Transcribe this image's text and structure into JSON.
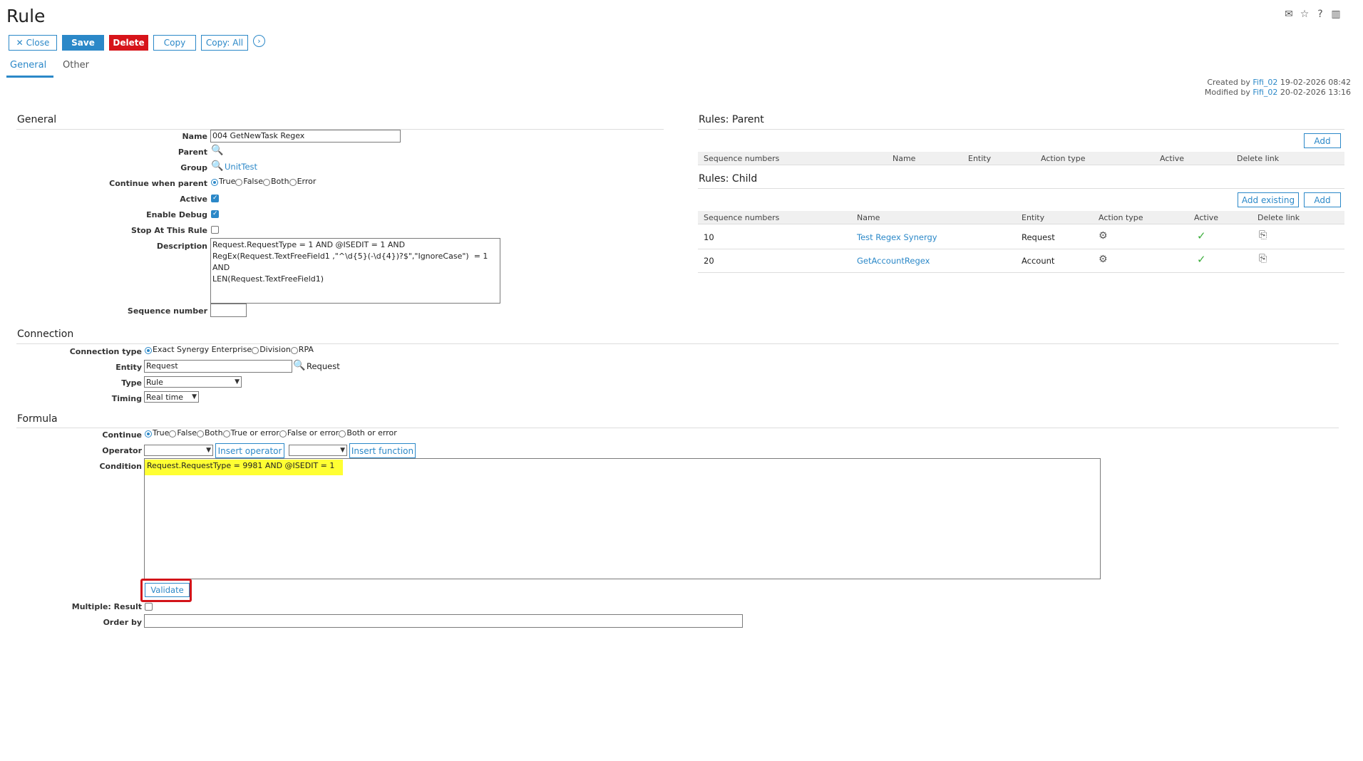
{
  "page": {
    "title": "Rule"
  },
  "toolbar": {
    "close_label": "Close",
    "save_label": "Save",
    "delete_label": "Delete",
    "copy_label": "Copy",
    "copy_all_label": "Copy: All"
  },
  "tabs": [
    {
      "label": "General"
    },
    {
      "label": "Other"
    }
  ],
  "meta": {
    "created_prefix": "Created by",
    "created_user": "Fifi_02",
    "created_date": "19-02-2026 08:42",
    "modified_prefix": "Modified by",
    "modified_user": "Fifi_02",
    "modified_date": "20-02-2026 13:16"
  },
  "general": {
    "heading": "General",
    "name_label": "Name",
    "name_value": "004 GetNewTask Regex",
    "parent_label": "Parent",
    "group_label": "Group",
    "group_value": "UnitTest",
    "continue_label": "Continue when parent",
    "continue_options": [
      "True",
      "False",
      "Both",
      "Error"
    ],
    "active_label": "Active",
    "debug_label": "Enable Debug",
    "stop_label": "Stop At This Rule",
    "description_label": "Description",
    "description_value": "Request.RequestType = 1 AND @ISEDIT = 1 AND\nRegEx(Request.TextFreeField1 ,\"^\\d{5}(-\\d{4})?$\",\"IgnoreCase\")  = 1 AND\nLEN(Request.TextFreeField1)",
    "sequence_label": "Sequence number",
    "sequence_value": ""
  },
  "connection": {
    "heading": "Connection",
    "type_label": "Connection type",
    "type_options": [
      "Exact Synergy Enterprise",
      "Division",
      "RPA"
    ],
    "entity_label": "Entity",
    "entity_value": "Request",
    "entity_link": "Request",
    "kind_label": "Type",
    "kind_value": "Rule",
    "timing_label": "Timing",
    "timing_value": "Real time"
  },
  "formula": {
    "heading": "Formula",
    "continue_label": "Continue",
    "continue_options": [
      "True",
      "False",
      "Both",
      "True or error",
      "False or error",
      "Both or error"
    ],
    "operator_label": "Operator",
    "insert_operator_label": "Insert operator",
    "insert_function_label": "Insert function",
    "condition_label": "Condition",
    "condition_value": "Request.RequestType = 9981 AND @ISEDIT = 1",
    "validate_label": "Validate",
    "multiple_label": "Multiple: Result",
    "orderby_label": "Order by",
    "orderby_value": ""
  },
  "rules_parent": {
    "heading": "Rules: Parent",
    "add_label": "Add",
    "columns": [
      "Sequence numbers",
      "Name",
      "Entity",
      "Action type",
      "Active",
      "Delete link"
    ]
  },
  "rules_child": {
    "heading": "Rules: Child",
    "add_existing_label": "Add existing",
    "add_label": "Add",
    "columns": [
      "Sequence numbers",
      "Name",
      "Entity",
      "Action type",
      "Active",
      "Delete link"
    ],
    "rows": [
      {
        "seq": "10",
        "name": "Test Regex Synergy",
        "entity": "Request"
      },
      {
        "seq": "20",
        "name": "GetAccountRegex",
        "entity": "Account"
      }
    ]
  },
  "colors": {
    "accent": "#2b88c8",
    "danger": "#d7141a",
    "highlight": "#ffff33"
  }
}
